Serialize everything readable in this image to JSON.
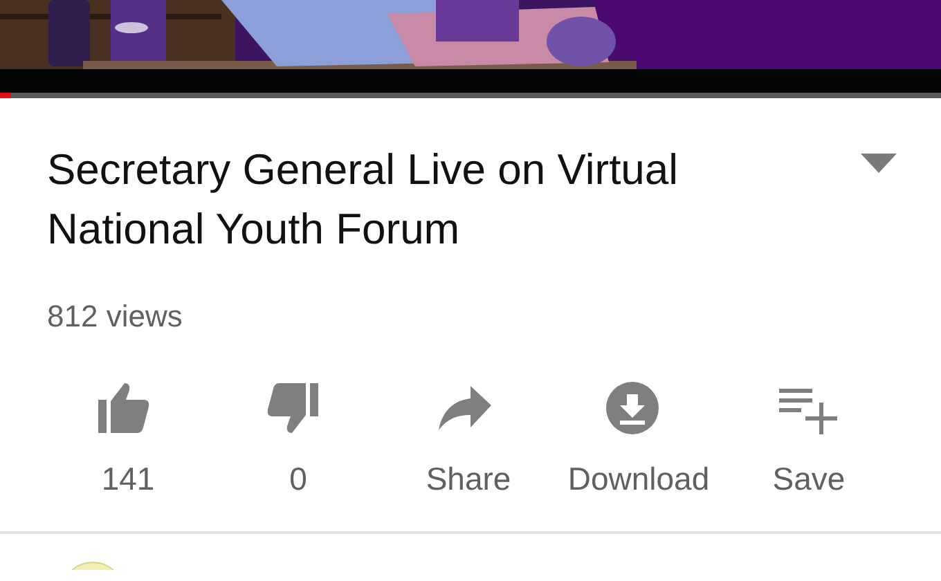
{
  "player": {
    "kind": "picture",
    "progress": {
      "level": 0.012
    }
  },
  "video": {
    "title": "Secretary General Live on Virtual National Youth Forum",
    "expanded": false,
    "views": "812 views"
  },
  "actions": [
    {
      "kind": "like",
      "label": "141"
    },
    {
      "kind": "dislike",
      "label": "0"
    },
    {
      "kind": "share",
      "label": "Share"
    },
    {
      "kind": "download",
      "label": "Download"
    },
    {
      "kind": "save",
      "label": "Save"
    }
  ]
}
